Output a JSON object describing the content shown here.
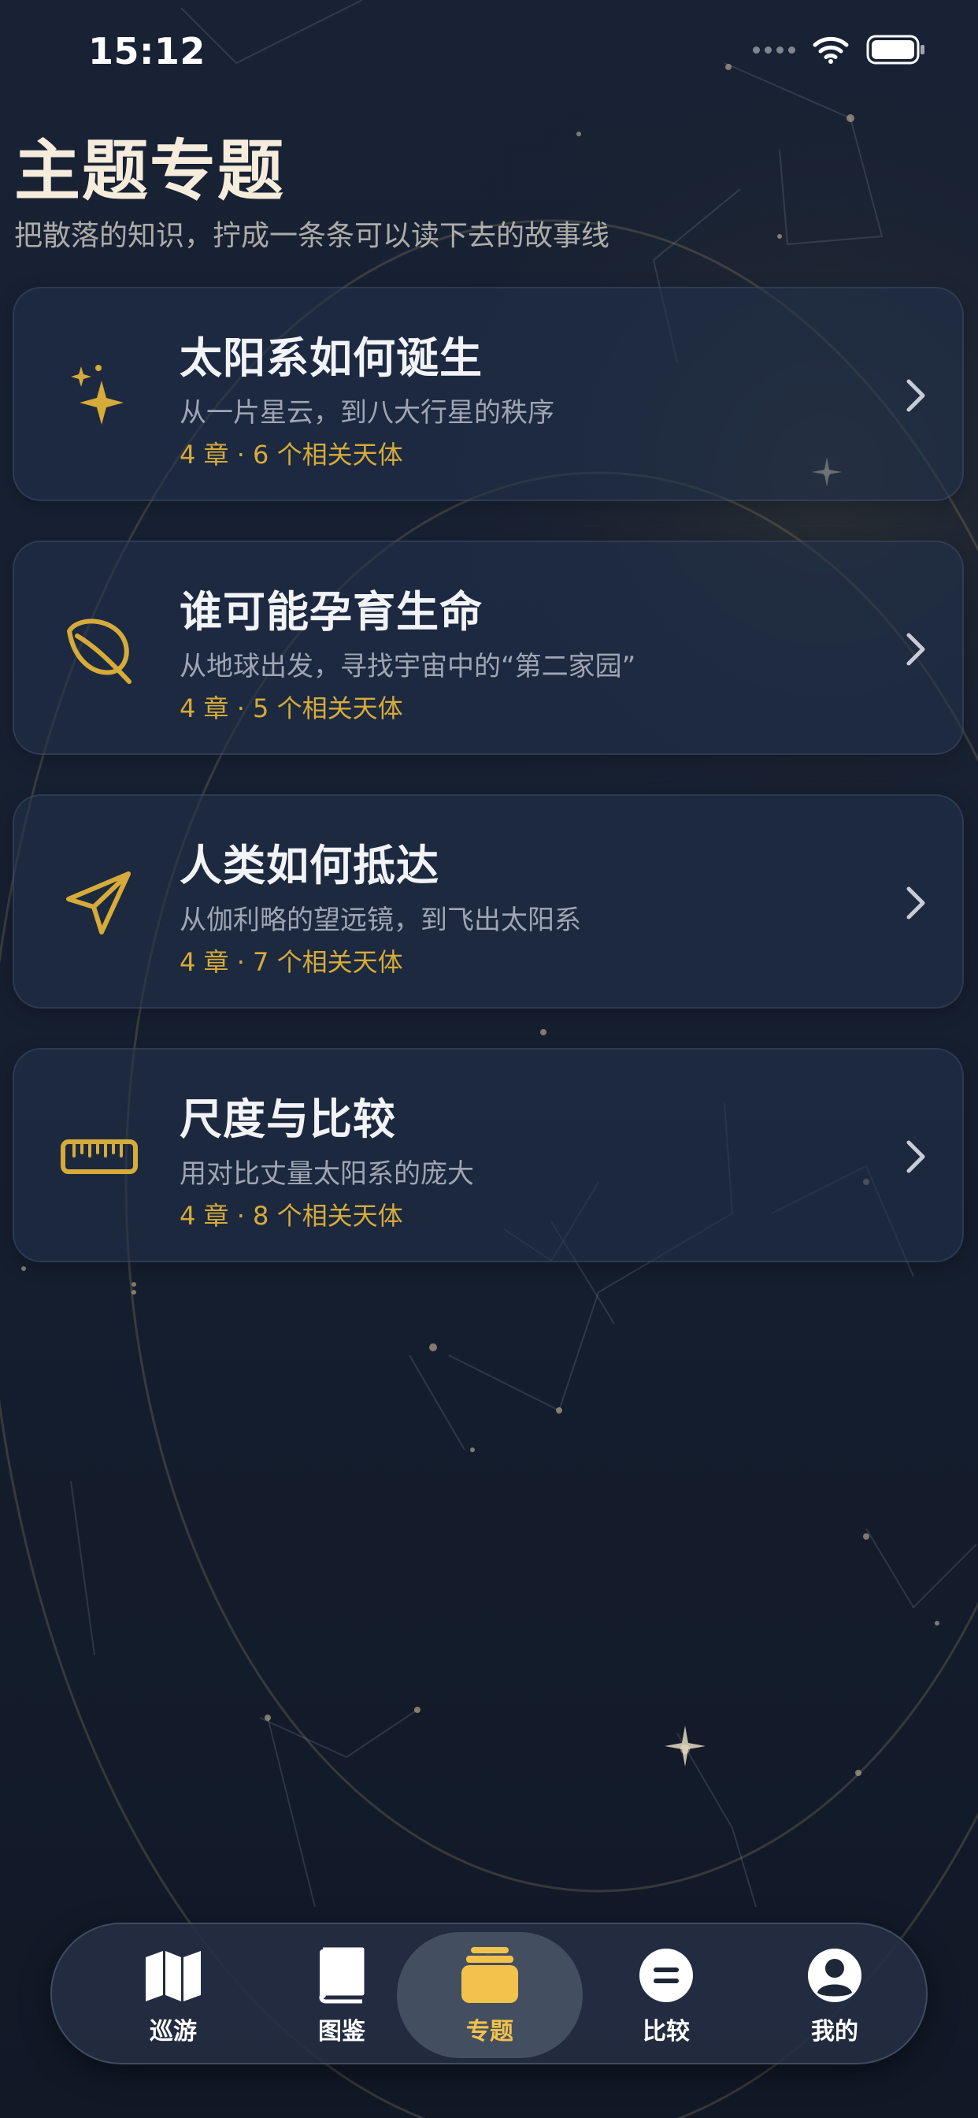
{
  "status_bar": {
    "time": "15:12"
  },
  "header": {
    "title": "主题专题",
    "subtitle": "把散落的知识，拧成一条条可以读下去的故事线"
  },
  "topics": [
    {
      "title": "太阳系如何诞生",
      "description": "从一片星云，到八大行星的秩序",
      "meta": "4 章 · 6 个相关天体",
      "icon": "sparkles-icon"
    },
    {
      "title": "谁可能孕育生命",
      "description": "从地球出发，寻找宇宙中的“第二家园”",
      "meta": "4 章 · 5 个相关天体",
      "icon": "leaf-icon"
    },
    {
      "title": "人类如何抵达",
      "description": "从伽利略的望远镜，到飞出太阳系",
      "meta": "4 章 · 7 个相关天体",
      "icon": "paper-plane-icon"
    },
    {
      "title": "尺度与比较",
      "description": "用对比丈量太阳系的庞大",
      "meta": "4 章 · 8 个相关天体",
      "icon": "ruler-icon"
    }
  ],
  "tabbar": {
    "tabs": [
      {
        "label": "巡游",
        "icon": "map-icon",
        "active": false
      },
      {
        "label": "图鉴",
        "icon": "book-icon",
        "active": false
      },
      {
        "label": "专题",
        "icon": "stack-icon",
        "active": true
      },
      {
        "label": "比较",
        "icon": "equals-circle-icon",
        "active": false
      },
      {
        "label": "我的",
        "icon": "person-circle-icon",
        "active": false
      }
    ]
  },
  "colors": {
    "background": "#141d2e",
    "accent_gold": "#d7ab3a",
    "active_tab_gold": "#f2c24a",
    "title_cream": "#f5ecdc"
  }
}
